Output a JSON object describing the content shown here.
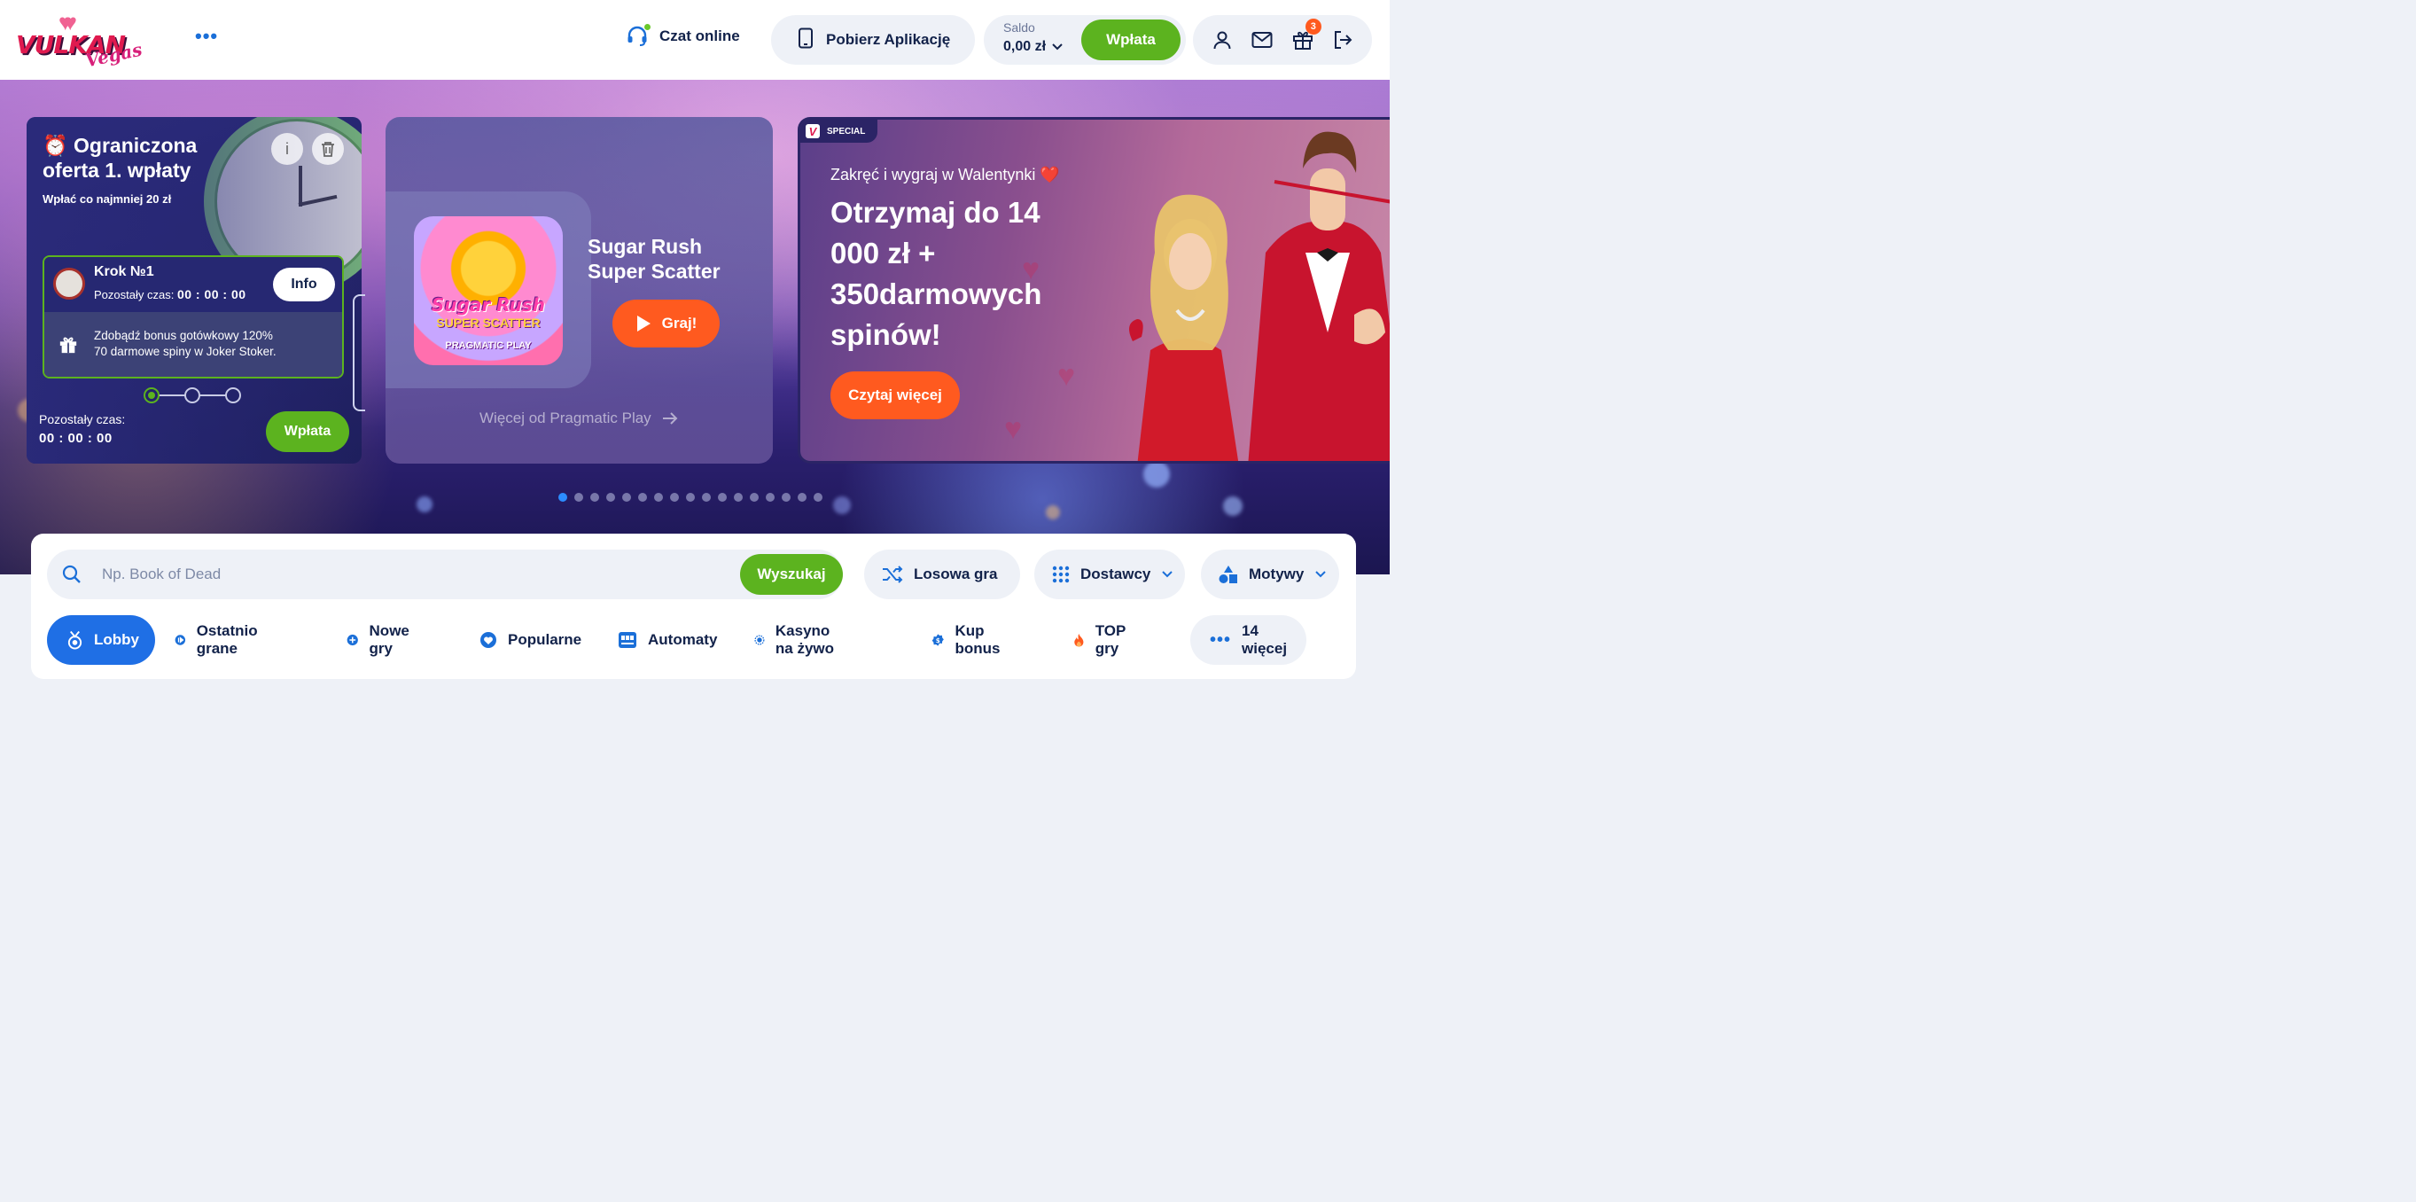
{
  "header": {
    "logo_text": "VULKAN",
    "logo_sub": "Vegas",
    "chat_label": "Czat online",
    "app_label": "Pobierz Aplikację",
    "balance_label": "Saldo",
    "balance_value": "0,00 zł",
    "deposit_label": "Wpłata",
    "gift_badge": "3"
  },
  "offer_card": {
    "title": "Ograniczona oferta 1. wpłaty",
    "subtitle": "Wpłać co najmniej 20 zł",
    "step_title": "Krok №1",
    "step_time_label": "Pozostały czas:",
    "step_time_value": "00 : 00 : 00",
    "info_label": "Info",
    "bonus_line1": "Zdobądź bonus gotówkowy 120%",
    "bonus_line2": "70 darmowe spiny w Joker Stoker.",
    "remaining_label": "Pozostały czas:",
    "remaining_value": "00 : 00 : 00",
    "deposit_label": "Wpłata"
  },
  "game_card": {
    "thumb_title": "Sugar Rush",
    "thumb_sub": "SUPER SCATTER",
    "thumb_provider": "PRAGMATIC PLAY",
    "title": "Sugar Rush Super Scatter",
    "play_label": "Graj!",
    "more_label": "Więcej od Pragmatic Play"
  },
  "promo_card": {
    "tag": "SPECIAL",
    "subtitle": "Zakręć i wygraj w Walentynki ❤️",
    "title": "Otrzymaj do 14 000 zł  + 350darmowych spinów!",
    "button_label": "Czytaj więcej"
  },
  "carousel": {
    "count": 17,
    "active_index": 0
  },
  "search": {
    "placeholder": "Np. Book of Dead",
    "button_label": "Wyszukaj",
    "random_label": "Losowa gra",
    "providers_label": "Dostawcy",
    "themes_label": "Motywy"
  },
  "categories": {
    "lobby": "Lobby",
    "recent": "Ostatnio grane",
    "new": "Nowe gry",
    "popular": "Popularne",
    "slots": "Automaty",
    "live": "Kasyno na żywo",
    "bonus_buy": "Kup bonus",
    "top": "TOP gry",
    "more": "14 więcej"
  },
  "colors": {
    "accent_blue": "#1f6fe5",
    "green": "#5cb31f",
    "orange": "#ff5a1f",
    "navy": "#12224a"
  }
}
